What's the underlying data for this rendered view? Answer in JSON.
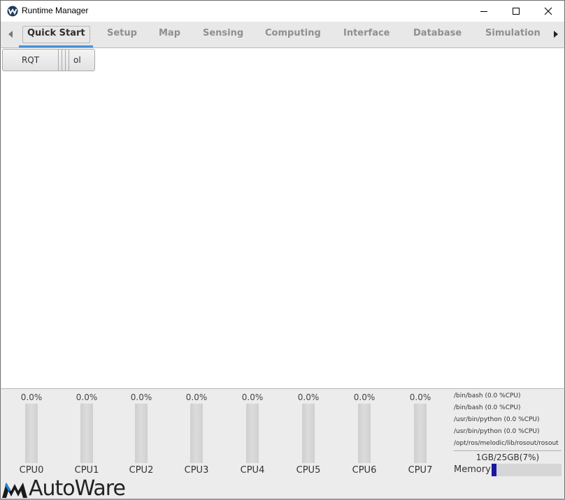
{
  "window": {
    "title": "Runtime Manager",
    "controls": [
      "minimize",
      "maximize",
      "close"
    ]
  },
  "tabs": [
    {
      "label": "Quick Start",
      "active": true
    },
    {
      "label": "Setup",
      "active": false
    },
    {
      "label": "Map",
      "active": false
    },
    {
      "label": "Sensing",
      "active": false
    },
    {
      "label": "Computing",
      "active": false
    },
    {
      "label": "Interface",
      "active": false
    },
    {
      "label": "Database",
      "active": false
    },
    {
      "label": "Simulation",
      "active": false
    }
  ],
  "toolbar": {
    "rqt_label": "RQT",
    "tool_label": "ol"
  },
  "cpus": [
    {
      "label": "CPU0",
      "usage": "0.0%",
      "fraction": 0.0
    },
    {
      "label": "CPU1",
      "usage": "0.0%",
      "fraction": 0.0
    },
    {
      "label": "CPU2",
      "usage": "0.0%",
      "fraction": 0.0
    },
    {
      "label": "CPU3",
      "usage": "0.0%",
      "fraction": 0.0
    },
    {
      "label": "CPU4",
      "usage": "0.0%",
      "fraction": 0.0
    },
    {
      "label": "CPU5",
      "usage": "0.0%",
      "fraction": 0.0
    },
    {
      "label": "CPU6",
      "usage": "0.0%",
      "fraction": 0.0
    },
    {
      "label": "CPU7",
      "usage": "0.0%",
      "fraction": 0.0
    }
  ],
  "processes": [
    "/bin/bash (0.0 %CPU)",
    "/bin/bash (0.0 %CPU)",
    "/usr/bin/python (0.0 %CPU)",
    "/usr/bin/python (0.0 %CPU)",
    "/opt/ros/melodic/lib/rosout/rosout"
  ],
  "memory": {
    "label": "Memory",
    "text": "1GB/25GB(7%)",
    "fraction": 0.07
  },
  "logo": {
    "text": "AutoWare"
  },
  "colors": {
    "accent": "#4a90d9",
    "bar_fill": "#1a1aa0",
    "tab_inactive": "#8f8f8f",
    "tab_active": "#2e2e2e"
  }
}
